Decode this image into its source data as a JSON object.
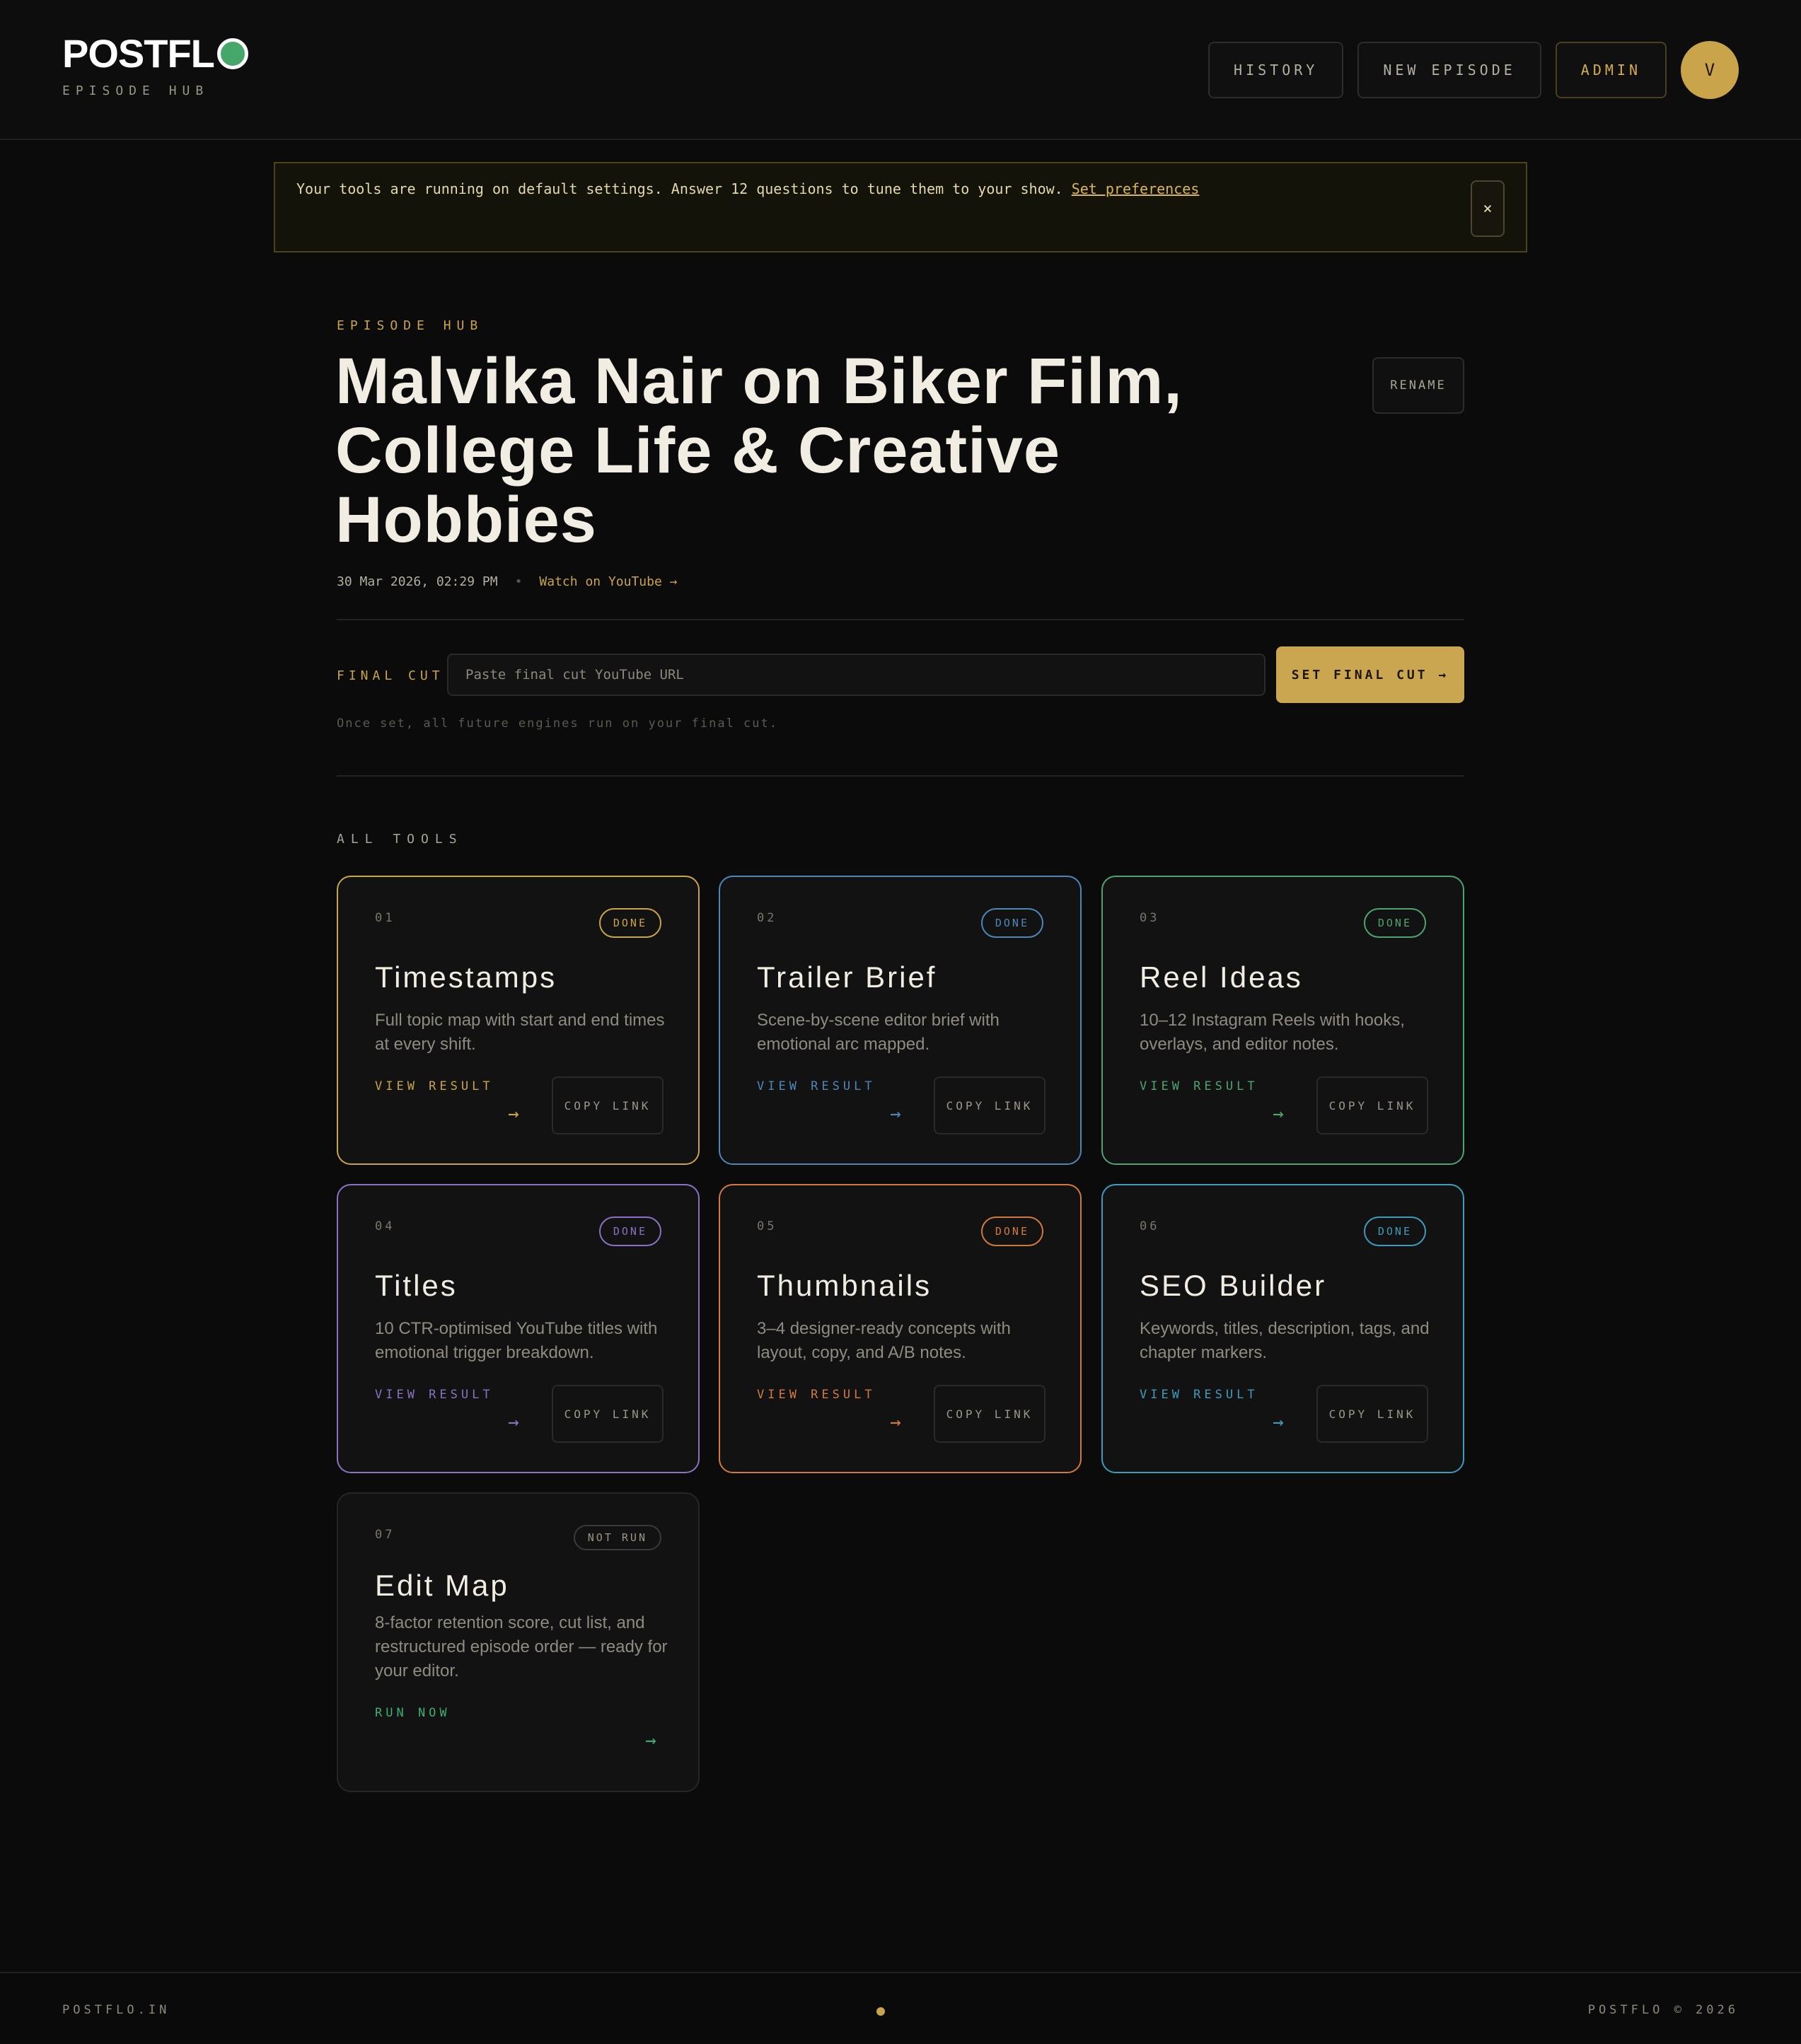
{
  "brand": {
    "logo": "POSTFL",
    "subtitle": "EPISODE HUB"
  },
  "nav": {
    "history": "HISTORY",
    "new_episode": "NEW EPISODE",
    "admin": "ADMIN",
    "avatar_initial": "V"
  },
  "banner": {
    "text": "Your tools are running on default settings. Answer 12 questions to tune them to your show.",
    "link": "Set preferences",
    "close": "×"
  },
  "hero": {
    "eyebrow": "EPISODE HUB",
    "title": "Malvika Nair on Biker Film, College Life & Creative Hobbies",
    "rename": "RENAME",
    "date": "30 Mar 2026, 02:29 PM",
    "separator": "•",
    "watch": "Watch on YouTube →"
  },
  "final_cut": {
    "label": "FINAL CUT",
    "placeholder": "Paste final cut YouTube URL",
    "value": "",
    "button": "SET FINAL CUT →",
    "help": "Once set, all future engines run on your final cut."
  },
  "tools": {
    "label": "ALL TOOLS",
    "copy_label": "COPY LINK",
    "arrow": "→",
    "items": [
      {
        "num": "01",
        "status": "DONE",
        "title": "Timestamps",
        "desc": "Full topic map with start and end times at every shift.",
        "action": "VIEW RESULT",
        "color": "#c9a44a"
      },
      {
        "num": "02",
        "status": "DONE",
        "title": "Trailer Brief",
        "desc": "Scene-by-scene editor brief with emotional arc mapped.",
        "action": "VIEW RESULT",
        "color": "#4f86b8"
      },
      {
        "num": "03",
        "status": "DONE",
        "title": "Reel Ideas",
        "desc": "10–12 Instagram Reels with hooks, overlays, and editor notes.",
        "action": "VIEW RESULT",
        "color": "#4fa371"
      },
      {
        "num": "04",
        "status": "DONE",
        "title": "Titles",
        "desc": "10 CTR-optimised YouTube titles with emotional trigger breakdown.",
        "action": "VIEW RESULT",
        "color": "#8a72c0"
      },
      {
        "num": "05",
        "status": "DONE",
        "title": "Thumbnails",
        "desc": "3–4 designer-ready concepts with layout, copy, and A/B notes.",
        "action": "VIEW RESULT",
        "color": "#d27a3e"
      },
      {
        "num": "06",
        "status": "DONE",
        "title": "SEO Builder",
        "desc": "Keywords, titles, description, tags, and chapter markers.",
        "action": "VIEW RESULT",
        "color": "#3f9bbc"
      },
      {
        "num": "07",
        "status": "NOT RUN",
        "title": "Edit Map",
        "desc": "8-factor retention score, cut list, and restructured episode order — ready for your editor.",
        "action": "RUN NOW",
        "color": "#3fae72"
      }
    ]
  },
  "footer": {
    "left": "POSTFLO.IN",
    "right": "POSTFLO © 2026"
  }
}
